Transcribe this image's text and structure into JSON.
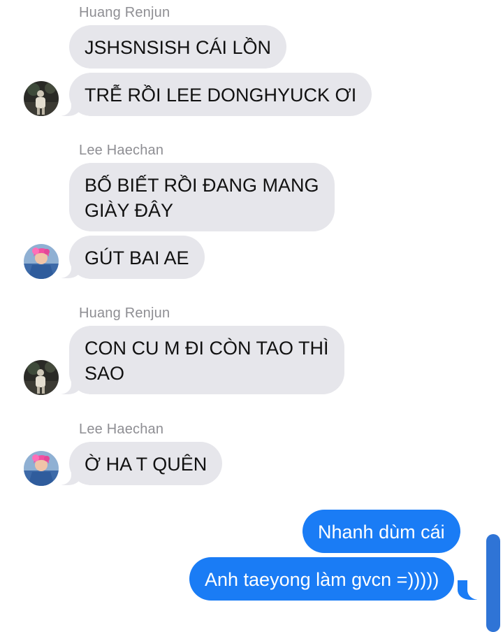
{
  "messages": [
    {
      "sender": "Huang Renjun"
    },
    {
      "text": "JSHSNSISH CÁI LỒN"
    },
    {
      "text": "TRỄ RỒI LEE DONGHYUCK ƠI"
    },
    {
      "sender": "Lee Haechan"
    },
    {
      "line1": "BỐ BIẾT RỒI ĐANG MANG",
      "line2": "GIÀY ĐÂY"
    },
    {
      "text": "GÚT BAI AE"
    },
    {
      "sender": "Huang Renjun"
    },
    {
      "line1": "CON CU M ĐI CÒN TAO THÌ",
      "line2": "SAO"
    },
    {
      "sender": "Lee Haechan"
    },
    {
      "text": "Ờ HA T QUÊN"
    },
    {
      "text": "Nhanh dùm cái"
    },
    {
      "text": "Anh taeyong làm gvcn =)))))"
    }
  ],
  "avatars": {
    "renjun": "renjun-avatar",
    "haechan": "haechan-avatar"
  },
  "colors": {
    "incoming_bubble": "#e6e6eb",
    "outgoing_bubble": "#1a7cf5",
    "sender_name": "#8e8e93"
  }
}
